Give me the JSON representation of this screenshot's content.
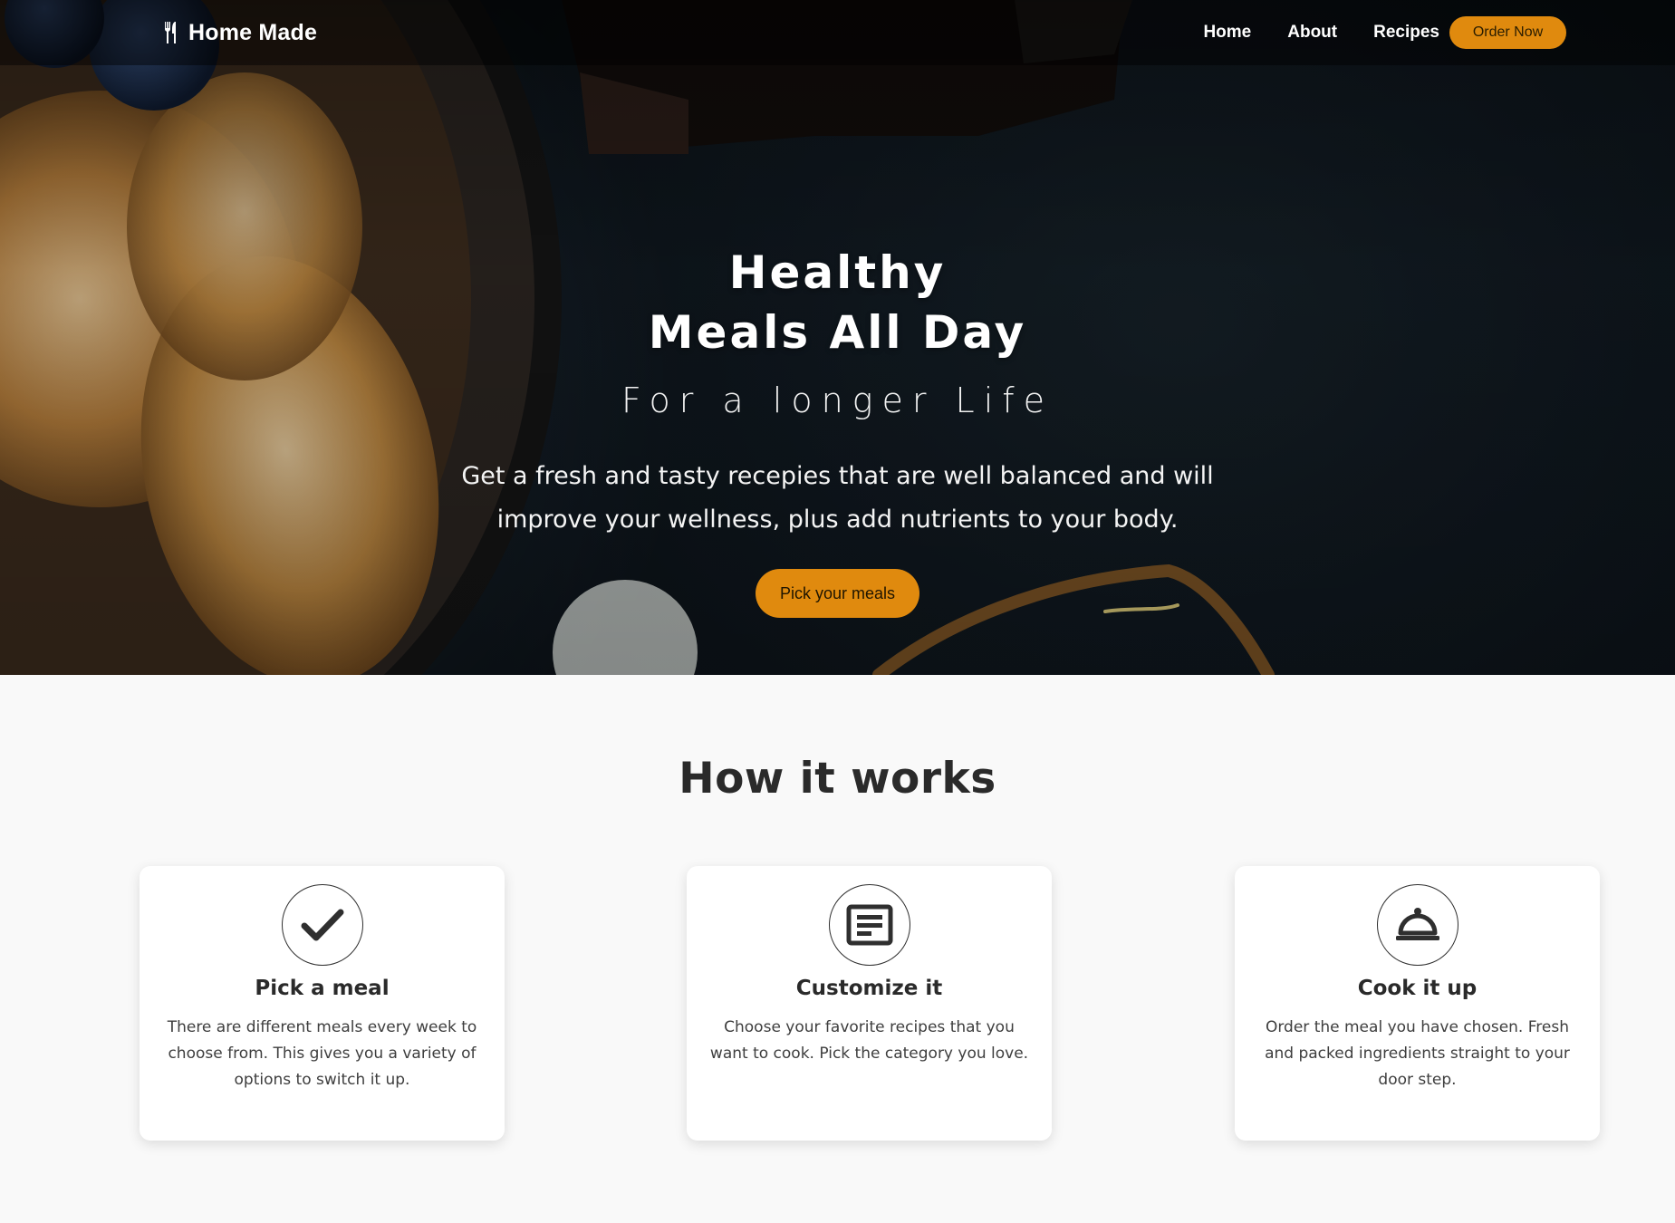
{
  "brand": {
    "name": "Home Made",
    "icon": "utensils-icon"
  },
  "nav": {
    "links": [
      "Home",
      "About",
      "Recipes"
    ],
    "cta_label": "Order Now"
  },
  "hero": {
    "title_line1": "Healthy",
    "title_line2": "Meals All Day",
    "subtitle": "For a longer Life",
    "description": "Get a fresh and tasty recepies that are well balanced and will improve your wellness, plus add nutrients to your body.",
    "button_label": "Pick your meals"
  },
  "how": {
    "title": "How it works",
    "steps": [
      {
        "icon": "checkmark-icon",
        "title": "Pick a meal",
        "text": "There are different meals every week to choose from. This gives you a variety of options to switch it up."
      },
      {
        "icon": "document-list-icon",
        "title": "Customize it",
        "text": "Choose your favorite recipes that you want to cook. Pick the category you love."
      },
      {
        "icon": "serving-cloche-icon",
        "title": "Cook it up",
        "text": "Order the meal you have chosen. Fresh and packed ingredients straight to your door step."
      }
    ]
  },
  "colors": {
    "accent": "#e08a0e",
    "hero_background": "#15202a",
    "page_background": "#f9f9f9",
    "text_dark": "#2a2a2a"
  }
}
